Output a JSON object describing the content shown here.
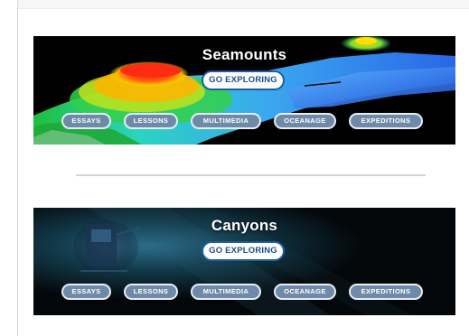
{
  "features": [
    {
      "title": "Seamounts",
      "button_label": "GO EXPLORING",
      "nav": [
        "ESSAYS",
        "LESSONS",
        "MULTIMEDIA",
        "OCEANAGE",
        "EXPEDITIONS"
      ]
    },
    {
      "title": "Canyons",
      "button_label": "GO EXPLORING",
      "nav": [
        "ESSAYS",
        "LESSONS",
        "MULTIMEDIA",
        "OCEANAGE",
        "EXPEDITIONS"
      ]
    }
  ],
  "colors": {
    "button_border": "#1f5d9c",
    "button_text": "#1f4f86",
    "pill_fill": "#6f8aa8",
    "pill_border": "#e8eef5",
    "divider": "#d4d4d4"
  }
}
